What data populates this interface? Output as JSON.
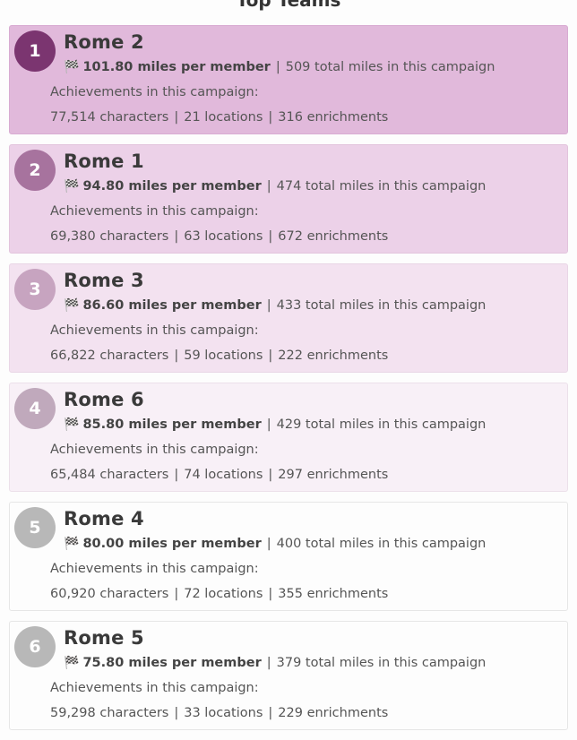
{
  "header": {
    "partial_title": "Top Teams"
  },
  "labels": {
    "achievements": "Achievements in this campaign:"
  },
  "teams": [
    {
      "rank": "1",
      "name": "Rome 2",
      "miles_per_member": "101.80 miles per member",
      "total_miles": "509 total miles in this campaign",
      "characters": "77,514 characters",
      "locations": "21 locations",
      "enrichments": "316 enrichments",
      "card_bg": "#e1b9db",
      "card_border": "#d8acd2",
      "badge_bg": "#7b3570"
    },
    {
      "rank": "2",
      "name": "Rome 1",
      "miles_per_member": "94.80 miles per member",
      "total_miles": "474 total miles in this campaign",
      "characters": "69,380 characters",
      "locations": "63 locations",
      "enrichments": "672 enrichments",
      "card_bg": "#ecd1e8",
      "card_border": "#e2c4dd",
      "badge_bg": "#a7739e"
    },
    {
      "rank": "3",
      "name": "Rome 3",
      "miles_per_member": "86.60 miles per member",
      "total_miles": "433 total miles in this campaign",
      "characters": "66,822 characters",
      "locations": "59 locations",
      "enrichments": "222 enrichments",
      "card_bg": "#f3e2f0",
      "card_border": "#e9d6e6",
      "badge_bg": "#c7a4c0"
    },
    {
      "rank": "4",
      "name": "Rome 6",
      "miles_per_member": "85.80 miles per member",
      "total_miles": "429 total miles in this campaign",
      "characters": "65,484 characters",
      "locations": "74 locations",
      "enrichments": "297 enrichments",
      "card_bg": "#f8f0f7",
      "card_border": "#ece0ea",
      "badge_bg": "#c0a9bc"
    },
    {
      "rank": "5",
      "name": "Rome 4",
      "miles_per_member": "80.00 miles per member",
      "total_miles": "400 total miles in this campaign",
      "characters": "60,920 characters",
      "locations": "72 locations",
      "enrichments": "355 enrichments",
      "card_bg": "#fdfdfd",
      "card_border": "#e6e6e6",
      "badge_bg": "#b8b8b8"
    },
    {
      "rank": "6",
      "name": "Rome 5",
      "miles_per_member": "75.80 miles per member",
      "total_miles": "379 total miles in this campaign",
      "characters": "59,298 characters",
      "locations": "33 locations",
      "enrichments": "229 enrichments",
      "card_bg": "#fdfdfd",
      "card_border": "#e6e6e6",
      "badge_bg": "#b8b8b8"
    }
  ]
}
